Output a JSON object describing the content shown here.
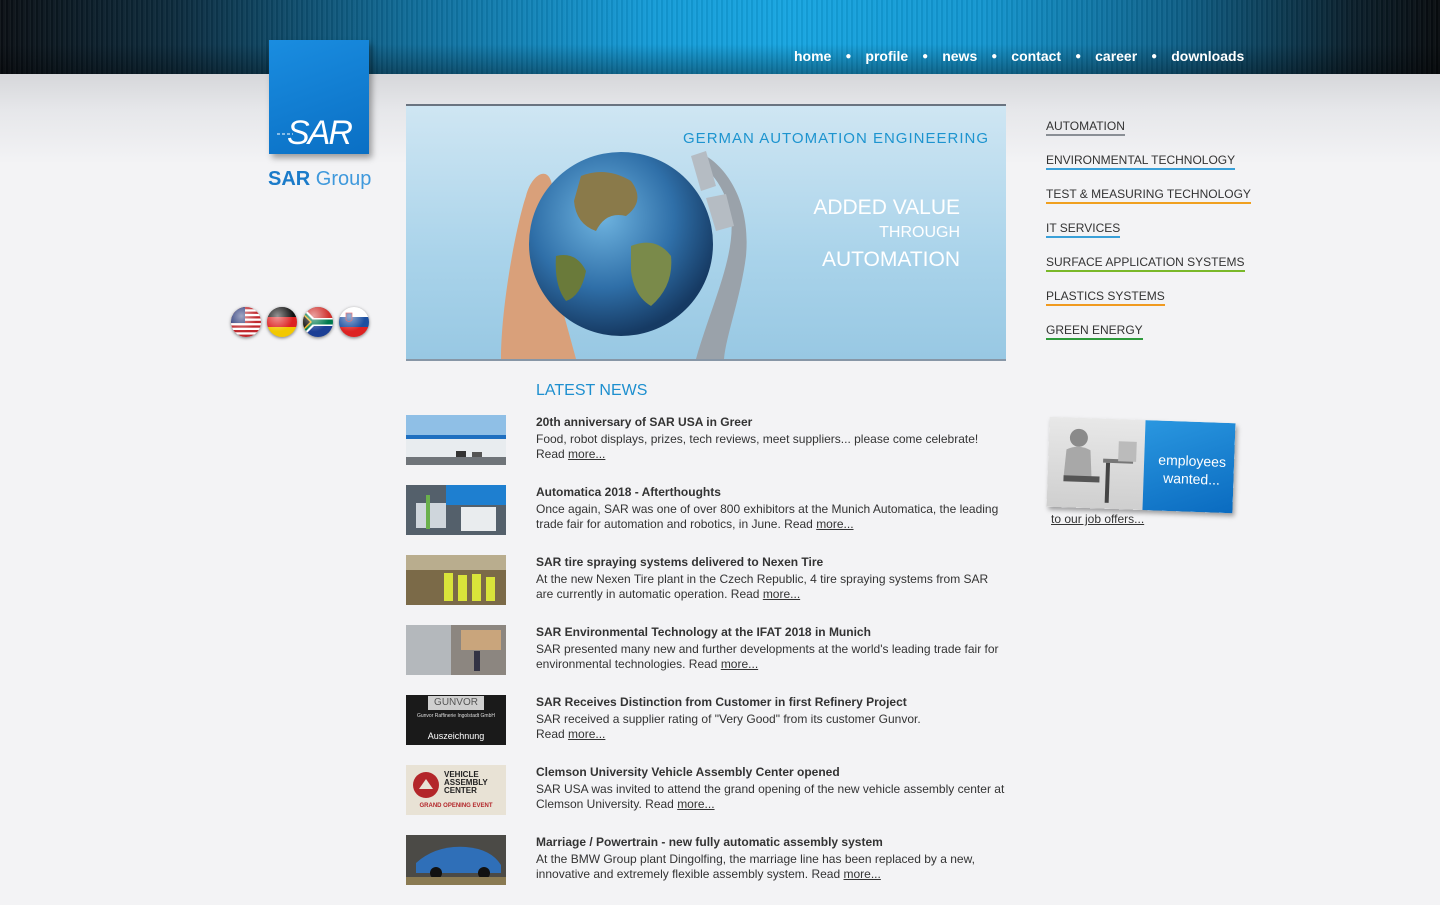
{
  "nav": [
    {
      "label": "home"
    },
    {
      "label": "profile"
    },
    {
      "label": "news"
    },
    {
      "label": "contact"
    },
    {
      "label": "career"
    },
    {
      "label": "downloads"
    }
  ],
  "logo": {
    "mark": "SAR",
    "word_bold": "SAR",
    "word_light": "Group"
  },
  "flags": [
    "us-flag-icon",
    "germany-flag-icon",
    "south-africa-flag-icon",
    "slovenia-flag-icon"
  ],
  "banner": {
    "tagline": "GERMAN AUTOMATION ENGINEERING",
    "line1": "ADDED VALUE",
    "line2": "THROUGH",
    "line3": "AUTOMATION"
  },
  "news": {
    "title": "LATEST NEWS",
    "read": "Read",
    "more": "more...",
    "items": [
      {
        "headline": "20th anniversary of SAR USA in Greer",
        "text": "Food, robot displays, prizes, tech reviews, meet suppliers... please come celebrate!"
      },
      {
        "headline": "Automatica 2018 - Afterthoughts",
        "text": "Once again, SAR was one of over 800 exhibitors at the Munich Automatica, the leading trade fair for automation and robotics, in June."
      },
      {
        "headline": "SAR tire spraying systems delivered to Nexen Tire",
        "text": "At the new Nexen Tire plant in the Czech Republic, 4 tire spraying systems from SAR are currently in automatic operation."
      },
      {
        "headline": "SAR Environmental Technology at the IFAT 2018 in Munich",
        "text": "SAR presented many new and further developments at the world's leading trade fair for environmental technologies."
      },
      {
        "headline": "SAR Receives Distinction from Customer in first Refinery Project",
        "text": "SAR received a supplier rating of \"Very Good\" from its customer Gunvor."
      },
      {
        "headline": "Clemson University Vehicle Assembly Center opened",
        "text": "SAR USA was invited to attend the grand opening of the new vehicle assembly center at Clemson University."
      },
      {
        "headline": "Marriage / Powertrain - new fully automatic assembly system",
        "text": "At the BMW Group plant Dingolfing, the marriage line has been replaced by a new, innovative and extremely flexible assembly system."
      }
    ],
    "thumb_texts": {
      "gunvor_top": "GUNVOR",
      "gunvor_mid": "Gunvor Raffinerie Ingolstadt GmbH",
      "gunvor_bottom": "Auszeichnung",
      "clemson_1": "VEHICLE",
      "clemson_2": "ASSEMBLY",
      "clemson_3": "CENTER",
      "clemson_4": "GRAND OPENING EVENT"
    }
  },
  "side_links": [
    {
      "label": "AUTOMATION",
      "color": "#8a8f95"
    },
    {
      "label": "ENVIRONMENTAL TECHNOLOGY",
      "color": "#3aa0d8"
    },
    {
      "label": "TEST & MEASURING TECHNOLOGY",
      "color": "#f0a020"
    },
    {
      "label": "IT SERVICES",
      "color": "#3aa0d8"
    },
    {
      "label": "SURFACE APPLICATION SYSTEMS",
      "color": "#7ab829"
    },
    {
      "label": "PLASTICS SYSTEMS",
      "color": "#f09a20"
    },
    {
      "label": "GREEN ENERGY",
      "color": "#2e9a3c"
    }
  ],
  "job": {
    "ad_line1": "employees",
    "ad_line2": "wanted...",
    "link": "to our job offers..."
  }
}
